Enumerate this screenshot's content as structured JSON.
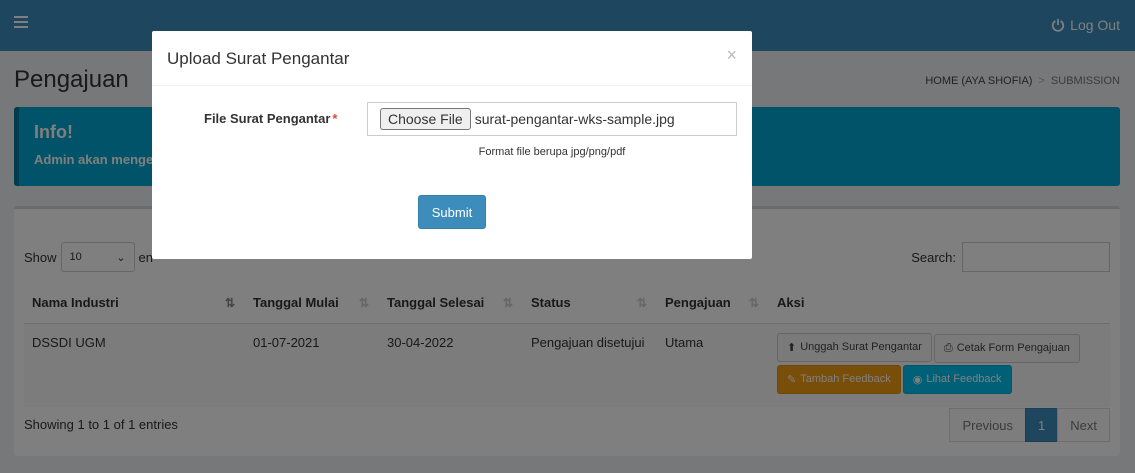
{
  "topbar": {
    "menu_icon": "hamburger-icon",
    "logout_icon": "power-icon",
    "logout_label": "Log Out",
    "bg_color": "#3c8dbc"
  },
  "page": {
    "title": "Pengajuan",
    "breadcrumb": {
      "home": "HOME (AYA SHOFIA)",
      "separator": ">",
      "current": "SUBMISSION"
    }
  },
  "callout": {
    "title": "Info!",
    "text": "Admin akan menge"
  },
  "table_controls": {
    "show_label": "Show",
    "entries_value": "10",
    "entries_suffix": "en",
    "search_label": "Search:"
  },
  "table": {
    "columns": [
      "Nama Industri",
      "Tanggal Mulai",
      "Tanggal Selesai",
      "Status",
      "Pengajuan",
      "Aksi"
    ],
    "rows": [
      {
        "nama_industri": "DSSDI UGM",
        "tanggal_mulai": "01-07-2021",
        "tanggal_selesai": "30-04-2022",
        "status": "Pengajuan disetujui",
        "pengajuan": "Utama",
        "actions": {
          "upload": "Unggah Surat Pengantar",
          "print": "Cetak Form Pengajuan",
          "add_feedback": "Tambah Feedback",
          "view_feedback": "Lihat Feedback"
        }
      }
    ]
  },
  "footer": {
    "info": "Showing 1 to 1 of 1 entries",
    "pagination": {
      "previous": "Previous",
      "current": "1",
      "next": "Next"
    }
  },
  "modal": {
    "title": "Upload Surat Pengantar",
    "close_symbol": "×",
    "file_label": "File Surat Pengantar",
    "required_mark": "*",
    "choose_button": "Choose File",
    "file_name": "surat-pengantar-wks-sample.jpg",
    "help_text": "Format file berupa jpg/png/pdf",
    "submit_label": "Submit"
  },
  "colors": {
    "primary": "#3c8dbc",
    "info": "#00c0ef",
    "warning": "#f39c12",
    "callout": "#00a7d0"
  }
}
